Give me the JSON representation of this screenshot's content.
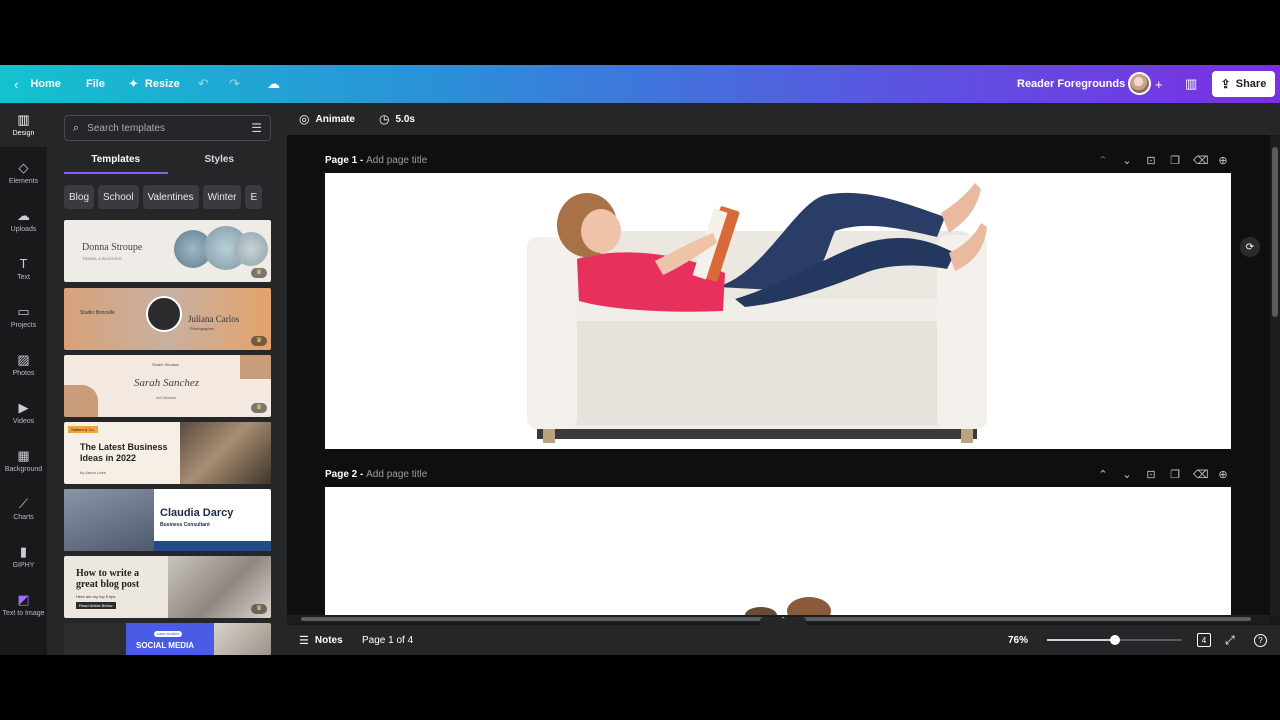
{
  "topbar": {
    "home_label": "Home",
    "file_label": "File",
    "resize_label": "Resize",
    "project_title": "Reader Foregrounds",
    "share_label": "Share"
  },
  "rail": {
    "items": [
      {
        "label": "Design",
        "icon": "layout-icon",
        "glyph": "▥"
      },
      {
        "label": "Elements",
        "icon": "shapes-icon",
        "glyph": "◇"
      },
      {
        "label": "Uploads",
        "icon": "cloud-upload-icon",
        "glyph": "☁"
      },
      {
        "label": "Text",
        "icon": "text-icon",
        "glyph": "T"
      },
      {
        "label": "Projects",
        "icon": "folder-icon",
        "glyph": "▭"
      },
      {
        "label": "Photos",
        "icon": "photo-icon",
        "glyph": "▨"
      },
      {
        "label": "Videos",
        "icon": "video-icon",
        "glyph": "▶"
      },
      {
        "label": "Background",
        "icon": "background-icon",
        "glyph": "▦"
      },
      {
        "label": "Charts",
        "icon": "chart-icon",
        "glyph": "⟋"
      },
      {
        "label": "GIPHY",
        "icon": "giphy-icon",
        "glyph": "▮"
      },
      {
        "label": "Text to Image",
        "icon": "text-to-image-icon",
        "glyph": "◩"
      }
    ]
  },
  "panel": {
    "search_placeholder": "Search templates",
    "tabs": [
      "Templates",
      "Styles"
    ],
    "chips": [
      "Blog",
      "School",
      "Valentines",
      "Winter",
      "E"
    ],
    "templates": [
      {
        "title": "Donna Stroupe",
        "subtitle": "TRAVEL & BLOGGER"
      },
      {
        "title": "Juliana Carlos",
        "subtitle": "Photographer",
        "extra": "Studio Boncelle"
      },
      {
        "title": "Sarah Sanchez",
        "subtitle": "Art Director",
        "extra": "Studio Shodwe"
      },
      {
        "title": "The Latest Business Ideas in 2022",
        "subtitle": "by Aaron Loeb",
        "extra": "Salford & Co."
      },
      {
        "title": "Claudia Darcy",
        "subtitle": "Business Consultant"
      },
      {
        "title": "How to write a great blog post",
        "subtitle": "Here are my top 5 tips",
        "extra": "Read Article Below"
      },
      {
        "title": "SOCIAL MEDIA",
        "subtitle": "case studies"
      }
    ]
  },
  "editor": {
    "animate_label": "Animate",
    "duration_label": "5.0s",
    "pages": [
      {
        "label": "Page 1 -",
        "placeholder": "Add page title"
      },
      {
        "label": "Page 2 -",
        "placeholder": "Add page title"
      }
    ]
  },
  "bottombar": {
    "notes_label": "Notes",
    "page_indicator": "Page 1 of 4",
    "zoom_label": "76%",
    "zoom_fraction": 0.5,
    "page_count_badge": "4"
  },
  "colors": {
    "accent": "#8b5cf6",
    "gradient_start": "#14c2cf",
    "gradient_end": "#7a2fe3"
  }
}
